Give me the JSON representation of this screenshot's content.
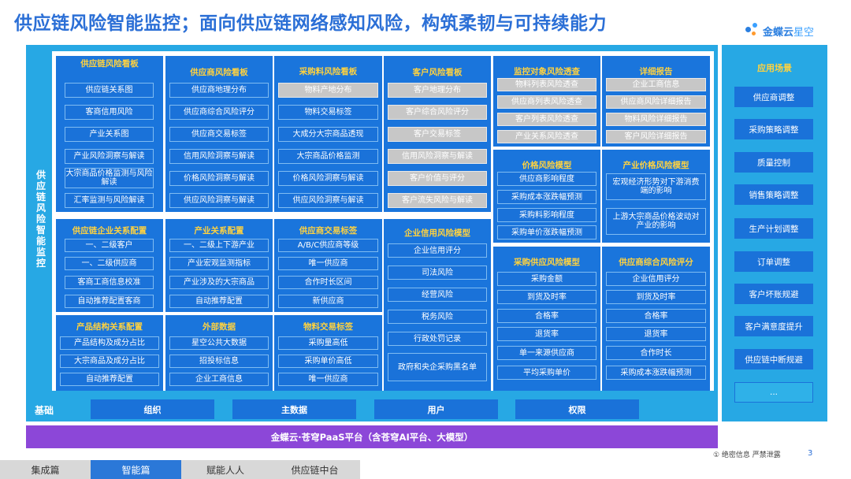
{
  "title": "供应链风险智能监控；面向供应链网络感知风险，构筑柔韧与可持续能力",
  "logo": {
    "brand": "金蝶云",
    "product": "星空"
  },
  "vertical_label": "供应链风险智能监控",
  "panels": {
    "p1": {
      "title": "供应链风险看板",
      "items": [
        "供应链关系图",
        "客商信用风险",
        "产业关系图",
        "产业风险洞察与解读",
        "大宗商品价格监测与风险解读",
        "汇率监测与风险解读"
      ]
    },
    "p2": {
      "title": "供应商风险看板",
      "items": [
        "供应商地理分布",
        "供应商综合风险评分",
        "供应商交易标签",
        "信用风险洞察与解读",
        "价格风险洞察与解读",
        "供应风险洞察与解读"
      ]
    },
    "p3": {
      "title": "采购料风险看板",
      "items": [
        "物料产地分布",
        "物料交易标签",
        "大成分大宗商品透现",
        "大宗商品价格监测",
        "价格风险洞察与解读",
        "供应风险洞察与解读"
      ]
    },
    "p4": {
      "title": "客户风险看板",
      "items": [
        "客户地理分布",
        "客户综合风险评分",
        "客户交易标签",
        "信用风险洞察与解读",
        "客户价值与评分",
        "客户流失风险与解读"
      ]
    },
    "p5": {
      "title": "监控对象风险透查",
      "items": [
        "物料列表风险透查",
        "供应商列表风险透查",
        "客户列表风险透查",
        "产业关系风险透查"
      ]
    },
    "p6": {
      "title": "详细报告",
      "items": [
        "企业工商信息",
        "供应商风险详细报告",
        "物料风险详细报告",
        "客户风险详细报告"
      ]
    },
    "p7": {
      "title": "价格风险模型",
      "items": [
        "供应商影响程度",
        "采购成本涨跌幅预测",
        "采购料影响程度",
        "采购单价涨跌幅预测"
      ]
    },
    "p8": {
      "title": "产业价格风险模型",
      "items": [
        "宏观经济形势对下游消费端的影响",
        "上游大宗商品价格波动对产业的影响"
      ]
    },
    "p9": {
      "title": "供应链企业关系配置",
      "items": [
        "一、二级客户",
        "一、二级供应商",
        "客商工商信息校准",
        "自动推荐配置客商"
      ]
    },
    "p10": {
      "title": "产业关系配置",
      "items": [
        "一、二级上下游产业",
        "产业宏观监测指标",
        "产业涉及的大宗商品",
        "自动推荐配置"
      ]
    },
    "p11": {
      "title": "供应商交易标签",
      "items": [
        "A/B/C供应商等级",
        "唯一供应商",
        "合作时长区间",
        "新供应商"
      ]
    },
    "p12": {
      "title": "企业信用风险模型",
      "items": [
        "企业信用评分",
        "司法风险",
        "经营风险",
        "税务风险",
        "行政处罚记录",
        "政府和央企采购黑名单"
      ]
    },
    "p13": {
      "title": "采购供应风险模型",
      "items": [
        "采购金额",
        "到货及时率",
        "合格率",
        "退货率",
        "单一来源供应商",
        "平均采购单价"
      ]
    },
    "p14": {
      "title": "供应商综合风险评分",
      "items": [
        "企业信用评分",
        "到货及时率",
        "合格率",
        "退货率",
        "合作时长",
        "采购成本涨跌幅预测"
      ]
    },
    "p15": {
      "title": "产品结构关系配置",
      "items": [
        "产品结构及成分占比",
        "大宗商品及成分占比",
        "自动推荐配置"
      ]
    },
    "p16": {
      "title": "外部数据",
      "items": [
        "星空公共大数据",
        "招投标信息",
        "企业工商信息"
      ]
    },
    "p17": {
      "title": "物料交易标签",
      "items": [
        "采购量高低",
        "采购单价高低",
        "唯一供应商"
      ]
    }
  },
  "scenarios": {
    "title": "应用场景",
    "items": [
      "供应商调整",
      "采购策略调整",
      "质量控制",
      "销售策略调整",
      "生产计划调整",
      "订单调整",
      "客户坏账规避",
      "客户满意度提升",
      "供应链中断规避",
      "..."
    ]
  },
  "base": {
    "label": "基础",
    "items": [
      "组织",
      "主数据",
      "用户",
      "权限"
    ]
  },
  "platform": "金蝶云·苍穹PaaS平台（含苍穹AI平台、大模型）",
  "footer": {
    "note": "① 绝密信息 严禁泄露",
    "page": "3",
    "tabs": [
      "集成篇",
      "智能篇",
      "赋能人人",
      "供应链中台"
    ],
    "active_tab": "智能篇"
  },
  "colors": {
    "primary_blue": "#1a75dc",
    "frame_blue": "#27a8e4",
    "header_yellow": "#ffd23f",
    "platform_purple": "#8c47d8",
    "title_blue": "#2b6fd6",
    "disabled_gray": "#c7c7c7"
  }
}
